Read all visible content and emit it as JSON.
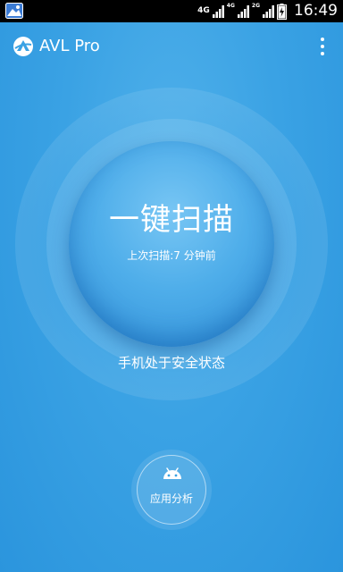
{
  "status_bar": {
    "network_1": "4G",
    "network_2": "4G",
    "network_3": "2G",
    "time": "16:49"
  },
  "app_bar": {
    "title": "AVL Pro"
  },
  "scan": {
    "title": "一键扫描",
    "last_scan": "上次扫描:7 分钟前"
  },
  "status_message": "手机处于安全状态",
  "app_analysis": {
    "label": "应用分析"
  },
  "icons": {
    "status_left": "gallery-notification-icon",
    "logo": "avl-logo-icon",
    "menu": "overflow-menu-icon",
    "analysis": "android-icon"
  },
  "colors": {
    "background": "#3aa2e4",
    "status_bar": "#000000",
    "text": "#ffffff"
  }
}
